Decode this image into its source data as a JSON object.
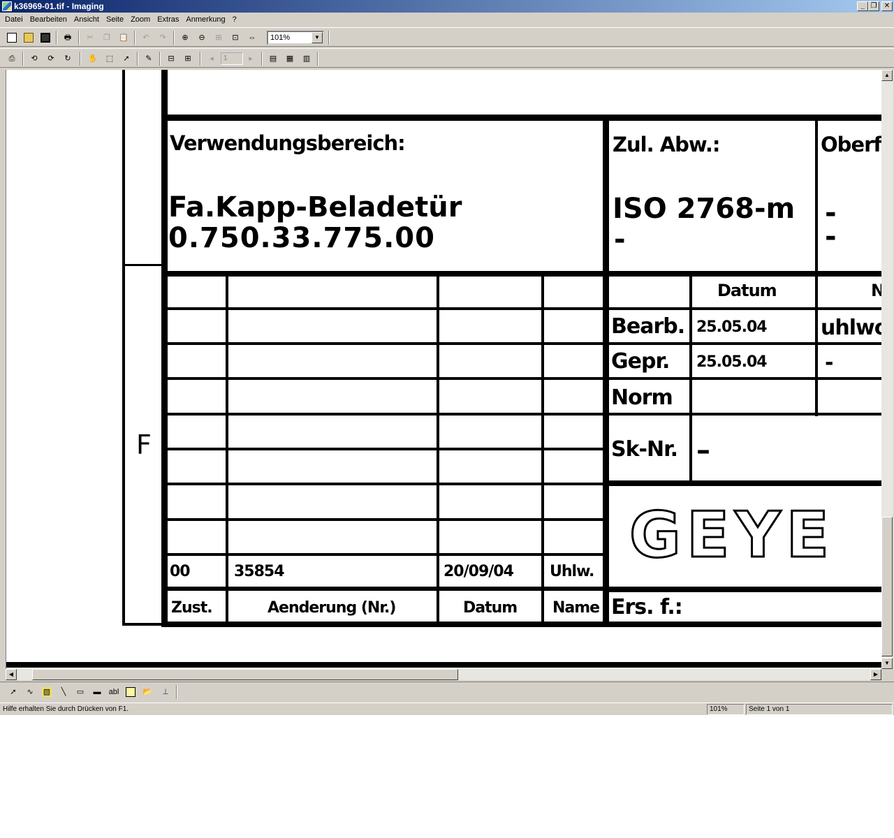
{
  "window": {
    "title": "k36969-01.tif - Imaging",
    "min_glyph": "_",
    "max_glyph": "❐",
    "close_glyph": "✕"
  },
  "menu": [
    "Datei",
    "Bearbeiten",
    "Ansicht",
    "Seite",
    "Zoom",
    "Extras",
    "Anmerkung",
    "?"
  ],
  "toolbar": {
    "zoom_value": "101%",
    "page_number": "1"
  },
  "drawing": {
    "margin_letter": "F",
    "usage_label": "Verwendungsbereich:",
    "usage_line1": "Fa.Kapp-Beladetür",
    "usage_line2": "0.750.33.775.00",
    "tolerance_label": "Zul. Abw.:",
    "tolerance_value": "ISO 2768-m",
    "tolerance_dash": "-",
    "surface_label": "Oberfl",
    "surface_dash1": "-",
    "surface_dash2": "-",
    "col_date": "Datum",
    "col_name": "Na",
    "row_bearb": "Bearb.",
    "row_gepr": "Gepr.",
    "row_norm": "Norm",
    "date_bearb": "25.05.04",
    "date_gepr": "25.05.04",
    "name_bearb": "uhlwo",
    "name_gepr": "-",
    "sk_label": "Sk-Nr.",
    "sk_value": "–",
    "rev_index": "00",
    "rev_change": "35854",
    "rev_date": "20/09/04",
    "rev_name": "Uhlw.",
    "hdr_zust": "Zust.",
    "hdr_change": "Aenderung (Nr.)",
    "hdr_date": "Datum",
    "hdr_name": "Name",
    "replaces_label": "Ers. f.:",
    "logo_text": "GEYE"
  },
  "statusbar": {
    "help": "Hilfe erhalten Sie durch Drücken von F1.",
    "zoom": "101%",
    "page": "Seite 1 von 1"
  }
}
